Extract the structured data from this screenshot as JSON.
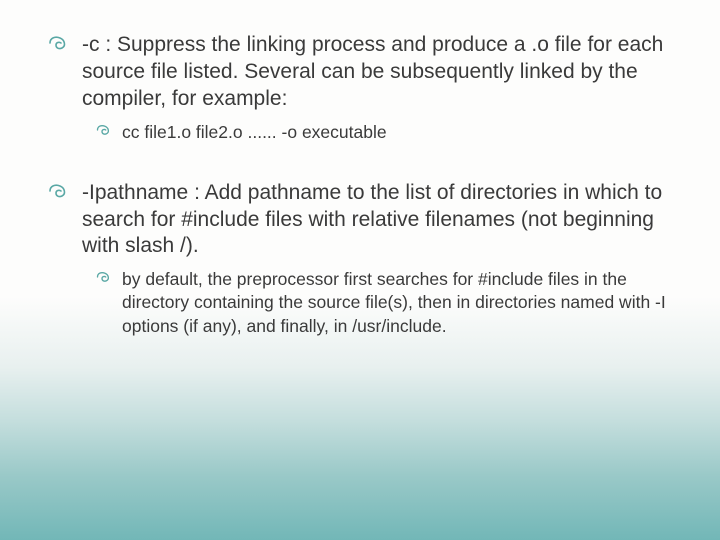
{
  "slide": {
    "items": [
      {
        "level": 1,
        "text": "-c :  Suppress the linking process and produce a .o file for each source file listed. Several can be subsequently linked by the compiler, for example:"
      },
      {
        "level": 2,
        "text": "cc file1.o file2.o ...... -o executable"
      },
      {
        "level": "gap"
      },
      {
        "level": 1,
        "text": "-Ipathname : Add pathname to the list of directories in which to search for #include files with relative filenames (not beginning with slash /)."
      },
      {
        "level": 2,
        "text": "by default, the preprocessor first searches for #include files in the directory containing the source file(s), then in directories named with -I options (if any), and finally, in /usr/include."
      }
    ]
  },
  "colors": {
    "text": "#3a3a3a",
    "bullet": "#5aa8a5"
  }
}
